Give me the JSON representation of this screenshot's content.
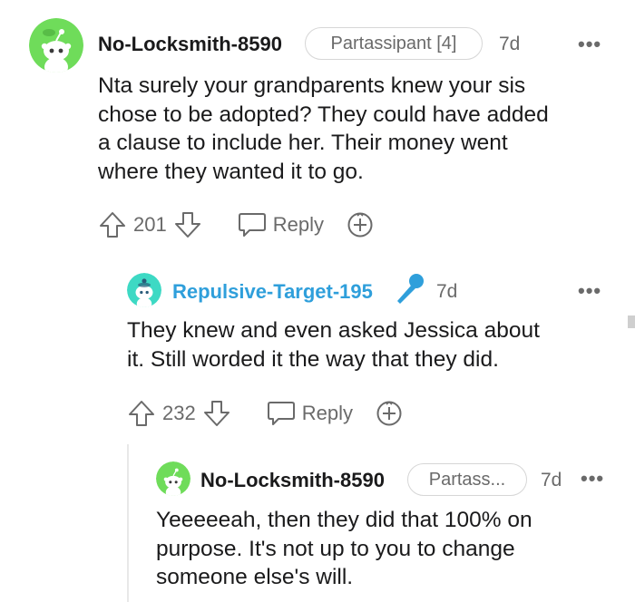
{
  "comments": [
    {
      "username": "No-Locksmith-8590",
      "flair": "Partassipant [4]",
      "time": "7d",
      "more": "•••",
      "lines": [
        "Nta surely your grandparents knew your sis",
        "chose to be adopted? They could have added",
        "a clause to include her. Their money went",
        "where they wanted it to go."
      ],
      "score": "201",
      "reply_label": "Reply",
      "avatar_color": "#6fdc5a"
    },
    {
      "username": "Repulsive-Target-195",
      "time": "7d",
      "more": "•••",
      "lines": [
        "They knew and even asked Jessica about",
        "it. Still worded it the way that they did."
      ],
      "score": "232",
      "reply_label": "Reply",
      "avatar_color": "#3dd9c4",
      "username_color": "#2f9fdb"
    },
    {
      "username": "No-Locksmith-8590",
      "flair": "Partass...",
      "time": "7d",
      "more": "•••",
      "lines": [
        "Yeeeeeah, then they did that 100% on",
        "purpose. It's not up to you to change",
        "someone else's will."
      ],
      "avatar_color": "#6fdc5a"
    }
  ]
}
